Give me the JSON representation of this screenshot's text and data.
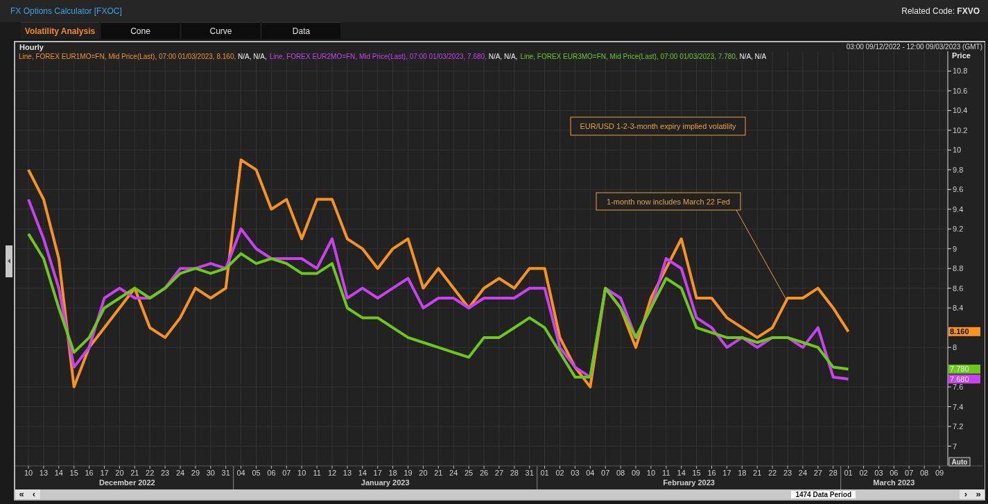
{
  "window": {
    "title": "FX Options Calculator [FXOC]",
    "related_code": "Related Code: **FXVO**"
  },
  "tabs": [
    {
      "label": "Volatility Analysis",
      "selected": true
    },
    {
      "label": "Cone",
      "selected": false
    },
    {
      "label": "Curve",
      "selected": false
    },
    {
      "label": "Data",
      "selected": false
    }
  ],
  "panel": {
    "interval": "Hourly",
    "range": "03:00 09/12/2022 - 12:00 09/03/2023 (GMT)",
    "auto_button": "Auto"
  },
  "legend": [
    {
      "prefix": "Line,",
      "detail": ", Mid Price(Last), 07:00 01/03/2023, 8.160,",
      "extra": "N/A, N/A,"
    },
    {
      "prefix": "Line,",
      "detail": ", Mid Price(Last), 07:00 01/03/2023, 7.680,",
      "extra": "N/A, N/A,"
    },
    {
      "prefix": "Line,",
      "detail": ", Mid Price(Last), 07:00 01/03/2023, 7.780,",
      "extra": "N/A, N/A"
    }
  ],
  "x_axis_groups": [
    "December 2022",
    "January 2023",
    "February 2023",
    "March 2023"
  ],
  "chart_data": {
    "type": "line",
    "ylabel": "Price",
    "grid": true,
    "categories": [
      "10",
      "13",
      "14",
      "15",
      "16",
      "17",
      "20",
      "21",
      "22",
      "23",
      "24",
      "29",
      "30",
      "31",
      "04",
      "05",
      "06",
      "07",
      "10",
      "11",
      "12",
      "13",
      "14",
      "17",
      "18",
      "19",
      "20",
      "21",
      "24",
      "25",
      "26",
      "27",
      "28",
      "31",
      "01",
      "02",
      "03",
      "04",
      "07",
      "08",
      "09",
      "10",
      "11",
      "14",
      "15",
      "16",
      "17",
      "18",
      "21",
      "22",
      "23",
      "24",
      "27",
      "28",
      "01",
      "02",
      "03",
      "06",
      "07",
      "08",
      "09"
    ],
    "ylim": [
      6.8,
      11.0
    ],
    "yticks": [
      7,
      7.2,
      7.4,
      7.6,
      8,
      8.4,
      8.6,
      8.8,
      9,
      9.2,
      9.4,
      9.6,
      9.8,
      10,
      10.2,
      10.4,
      10.6,
      10.8
    ],
    "series": [
      {
        "name": "FOREX EUR1MO=FN",
        "color": "#f7931e",
        "values": [
          9.8,
          9.5,
          8.9,
          7.6,
          8.0,
          8.2,
          8.4,
          8.6,
          8.2,
          8.1,
          8.3,
          8.6,
          8.5,
          8.6,
          9.9,
          9.8,
          9.4,
          9.5,
          9.1,
          9.5,
          9.5,
          9.1,
          9.0,
          8.8,
          9.0,
          9.1,
          8.6,
          8.8,
          8.6,
          8.4,
          8.6,
          8.7,
          8.6,
          8.8,
          8.8,
          8.1,
          7.8,
          7.6,
          8.6,
          8.4,
          8.0,
          8.5,
          8.8,
          9.1,
          8.5,
          8.5,
          8.3,
          8.2,
          8.1,
          8.2,
          8.5,
          8.5,
          8.6,
          8.4,
          8.16,
          null,
          null,
          null,
          null,
          null,
          null
        ]
      },
      {
        "name": "FOREX EUR2MO=FN",
        "color": "#c941f0",
        "values": [
          9.5,
          9.1,
          8.6,
          7.8,
          8.0,
          8.5,
          8.6,
          8.5,
          8.5,
          8.6,
          8.8,
          8.8,
          8.85,
          8.8,
          9.2,
          9.0,
          8.9,
          8.9,
          8.9,
          8.8,
          9.1,
          8.5,
          8.6,
          8.5,
          8.6,
          8.7,
          8.4,
          8.5,
          8.5,
          8.4,
          8.5,
          8.5,
          8.5,
          8.6,
          8.6,
          8.0,
          7.8,
          7.7,
          8.6,
          8.5,
          8.1,
          8.4,
          8.9,
          8.8,
          8.3,
          8.2,
          8.0,
          8.1,
          8.0,
          8.1,
          8.1,
          8.0,
          8.2,
          7.7,
          7.68,
          null,
          null,
          null,
          null,
          null,
          null
        ]
      },
      {
        "name": "FOREX EUR3MO=FN",
        "color": "#6cc91c",
        "values": [
          9.15,
          8.9,
          8.4,
          7.95,
          8.1,
          8.4,
          8.5,
          8.6,
          8.5,
          8.6,
          8.75,
          8.8,
          8.75,
          8.8,
          8.95,
          8.85,
          8.9,
          8.85,
          8.75,
          8.75,
          8.85,
          8.4,
          8.3,
          8.3,
          8.2,
          8.1,
          8.05,
          8.0,
          7.95,
          7.9,
          8.1,
          8.1,
          8.2,
          8.3,
          8.2,
          7.95,
          7.7,
          7.7,
          8.6,
          8.4,
          8.1,
          8.4,
          8.7,
          8.6,
          8.2,
          8.15,
          8.1,
          8.1,
          8.05,
          8.1,
          8.1,
          8.05,
          8.0,
          7.8,
          7.78,
          null,
          null,
          null,
          null,
          null,
          null
        ]
      }
    ],
    "annotations": [
      {
        "text": "EUR/USD 1-2-3-month expiry implied volatility"
      },
      {
        "text": "1-month now includes March 22 Fed"
      }
    ]
  },
  "price_badges": [
    {
      "text": "8.160",
      "color": "#f7931e"
    },
    {
      "text": "7.780",
      "color": "#6cc91c"
    },
    {
      "text": "7.680",
      "color": "#c941f0"
    }
  ],
  "scrollbar": {
    "first": "«",
    "prev": "‹",
    "period": "1474 Data Period",
    "next": "›",
    "last": "»"
  }
}
